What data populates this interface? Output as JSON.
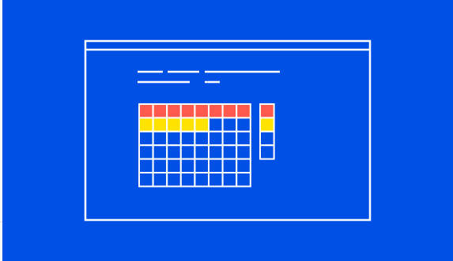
{
  "illustration": {
    "subject": "spreadsheet-window",
    "colors": {
      "background": "#0050E6",
      "line": "#FFFFFF",
      "row_red": "#FF5A4D",
      "row_yellow": "#FFE300",
      "cell_empty": "#0050E6"
    },
    "grid": {
      "rows": 6,
      "cols": 8,
      "filled_red_row_cells": 8,
      "filled_yellow_row_cells": 5
    },
    "side_column": {
      "rows": 4,
      "filled": [
        "red",
        "yellow",
        "empty",
        "empty"
      ]
    }
  }
}
